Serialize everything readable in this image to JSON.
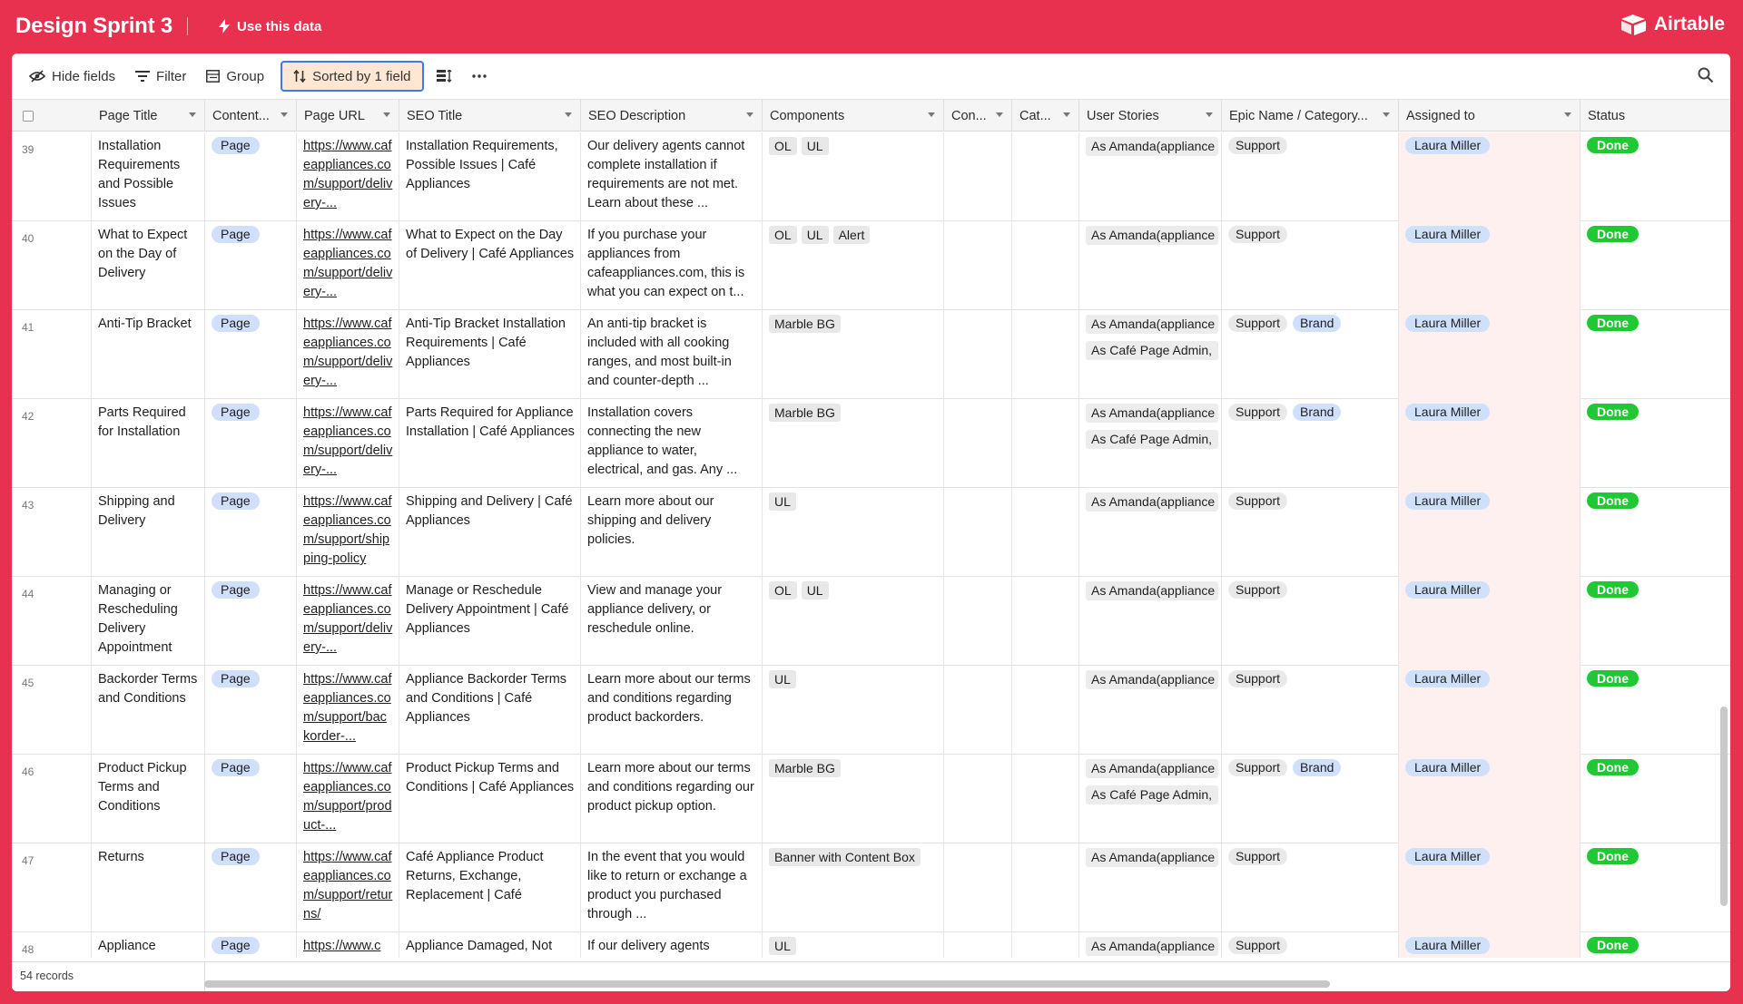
{
  "app": {
    "base_title": "Design Sprint 3",
    "use_data_label": "Use this data",
    "brand": "Airtable"
  },
  "toolbar": {
    "hide_fields": "Hide fields",
    "filter": "Filter",
    "group": "Group",
    "sorted": "Sorted by 1 field"
  },
  "columns": [
    "Page Title",
    "Content...",
    "Page URL",
    "SEO Title",
    "SEO Description",
    "Components",
    "Con...",
    "Cat...",
    "User Stories",
    "Epic Name / Category...",
    "Assigned to",
    "Status"
  ],
  "rows": [
    {
      "num": "39",
      "title": "Installation Requirements and Possible Issues",
      "content": "Page",
      "url": "https://www.cafeappliances.com/support/delivery-...",
      "seo_title": "Installation Requirements, Possible Issues | Café Appliances",
      "seo_desc": "Our delivery agents cannot complete installation if requirements are not met. Learn about these ...",
      "components": [
        "OL",
        "UL"
      ],
      "stories": [
        "As Amanda(appliance"
      ],
      "epic": [
        "Support"
      ],
      "assigned": "Laura Miller",
      "status": "Done"
    },
    {
      "num": "40",
      "title": "What to Expect on the Day of Delivery",
      "content": "Page",
      "url": "https://www.cafeappliances.com/support/delivery-...",
      "seo_title": "What to Expect on the Day of Delivery | Café Appliances",
      "seo_desc": "If you purchase your appliances from cafeappliances.com, this is what you can expect on t...",
      "components": [
        "OL",
        "UL",
        "Alert"
      ],
      "stories": [
        "As Amanda(appliance"
      ],
      "epic": [
        "Support"
      ],
      "assigned": "Laura Miller",
      "status": "Done"
    },
    {
      "num": "41",
      "title": "Anti-Tip Bracket",
      "content": "Page",
      "url": "https://www.cafeappliances.com/support/delivery-...",
      "seo_title": "Anti-Tip Bracket Installation Requirements | Café Appliances",
      "seo_desc": "An anti-tip bracket is included with all cooking ranges, and most built-in and counter-depth ...",
      "components": [
        "Marble BG"
      ],
      "stories": [
        "As Amanda(appliance",
        "As Café Page Admin,"
      ],
      "epic": [
        "Support",
        "Brand"
      ],
      "assigned": "Laura Miller",
      "status": "Done"
    },
    {
      "num": "42",
      "title": "Parts Required for Installation",
      "content": "Page",
      "url": "https://www.cafeappliances.com/support/delivery-...",
      "seo_title": "Parts Required for Appliance Installation | Café Appliances",
      "seo_desc": "Installation covers connecting the new appliance to water, electrical, and gas. Any ...",
      "components": [
        "Marble BG"
      ],
      "stories": [
        "As Amanda(appliance",
        "As Café Page Admin,"
      ],
      "epic": [
        "Support",
        "Brand"
      ],
      "assigned": "Laura Miller",
      "status": "Done"
    },
    {
      "num": "43",
      "title": "Shipping and Delivery",
      "content": "Page",
      "url": "https://www.cafeappliances.com/support/shipping-policy",
      "seo_title": "Shipping and Delivery | Café Appliances",
      "seo_desc": "Learn more about our shipping and delivery policies.",
      "components": [
        "UL"
      ],
      "stories": [
        "As Amanda(appliance"
      ],
      "epic": [
        "Support"
      ],
      "assigned": "Laura Miller",
      "status": "Done"
    },
    {
      "num": "44",
      "title": "Managing or Rescheduling Delivery Appointment",
      "content": "Page",
      "url": "https://www.cafeappliances.com/support/delivery-...",
      "seo_title": "Manage or Reschedule Delivery Appointment | Café Appliances",
      "seo_desc": "View and manage your appliance delivery, or reschedule online.",
      "components": [
        "OL",
        "UL"
      ],
      "stories": [
        "As Amanda(appliance"
      ],
      "epic": [
        "Support"
      ],
      "assigned": "Laura Miller",
      "status": "Done"
    },
    {
      "num": "45",
      "title": "Backorder Terms and Conditions",
      "content": "Page",
      "url": "https://www.cafeappliances.com/support/backorder-...",
      "seo_title": "Appliance Backorder Terms and Conditions | Café Appliances",
      "seo_desc": "Learn more about our terms and conditions regarding product backorders.",
      "components": [
        "UL"
      ],
      "stories": [
        "As Amanda(appliance"
      ],
      "epic": [
        "Support"
      ],
      "assigned": "Laura Miller",
      "status": "Done"
    },
    {
      "num": "46",
      "title": "Product Pickup Terms and Conditions",
      "content": "Page",
      "url": "https://www.cafeappliances.com/support/product-...",
      "seo_title": "Product Pickup Terms and Conditions | Café Appliances",
      "seo_desc": "Learn more about our terms and conditions regarding our product pickup option.",
      "components": [
        "Marble BG"
      ],
      "stories": [
        "As Amanda(appliance",
        "As Café Page Admin,"
      ],
      "epic": [
        "Support",
        "Brand"
      ],
      "assigned": "Laura Miller",
      "status": "Done"
    },
    {
      "num": "47",
      "title": "Returns",
      "content": "Page",
      "url": "https://www.cafeappliances.com/support/returns/",
      "seo_title": "Café Appliance Product Returns, Exchange, Replacement | Café",
      "seo_desc": "In the event that you would like to return or exchange a product you purchased through ...",
      "components": [
        "Banner with Content Box"
      ],
      "stories": [
        "As Amanda(appliance"
      ],
      "epic": [
        "Support"
      ],
      "assigned": "Laura Miller",
      "status": "Done"
    },
    {
      "num": "48",
      "title": "Appliance",
      "content": "Page",
      "url": "https://www.c",
      "seo_title": "Appliance Damaged, Not",
      "seo_desc": "If our delivery agents",
      "components": [
        "UL"
      ],
      "stories": [
        "As Amanda(appliance"
      ],
      "epic": [
        "Support"
      ],
      "assigned": "Laura Miller",
      "status": "Done"
    }
  ],
  "footer": {
    "records": "54 records"
  },
  "colors": {
    "brand_red": "#e8304f",
    "done_green": "#20c933",
    "sort_outline": "#3a7bea"
  }
}
